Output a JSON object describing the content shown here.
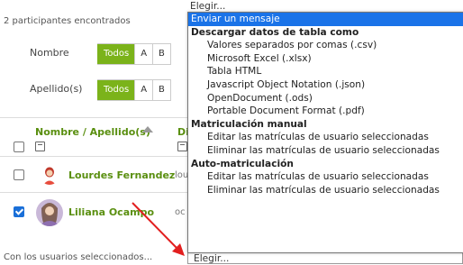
{
  "summary": "2 participantes encontrados",
  "filters": [
    {
      "label": "Nombre",
      "buttons": [
        "Todos",
        "A",
        "B"
      ]
    },
    {
      "label": "Apellido(s)",
      "buttons": [
        "Todos",
        "A",
        "B"
      ]
    }
  ],
  "table": {
    "header": "Nombre / Apellido(s)",
    "header_2": "Di",
    "rows": [
      {
        "name": "Lourdes Fernandez",
        "extra": "lou",
        "checked": false
      },
      {
        "name": "Liliana Ocampo",
        "extra": "oc",
        "checked": true
      }
    ]
  },
  "footer": "Con los usuarios seleccionados...",
  "select": {
    "current": "Elegir...",
    "options": [
      {
        "text": "Elegir...",
        "kind": "option-top"
      },
      {
        "text": "Enviar un mensaje",
        "kind": "highlight"
      },
      {
        "text": "Descargar datos de tabla como",
        "kind": "group"
      },
      {
        "text": "Valores separados por comas (.csv)",
        "kind": "option"
      },
      {
        "text": "Microsoft Excel (.xlsx)",
        "kind": "option"
      },
      {
        "text": "Tabla HTML",
        "kind": "option"
      },
      {
        "text": "Javascript Object Notation (.json)",
        "kind": "option"
      },
      {
        "text": "OpenDocument (.ods)",
        "kind": "option"
      },
      {
        "text": "Portable Document Format (.pdf)",
        "kind": "option"
      },
      {
        "text": "Matriculación manual",
        "kind": "group"
      },
      {
        "text": "Editar las matrículas de usuario seleccionadas",
        "kind": "option"
      },
      {
        "text": "Eliminar las matrículas de usuario seleccionadas",
        "kind": "option"
      },
      {
        "text": "Auto-matriculación",
        "kind": "group"
      },
      {
        "text": "Editar las matrículas de usuario seleccionadas",
        "kind": "option"
      },
      {
        "text": "Eliminar las matrículas de usuario seleccionadas",
        "kind": "option"
      }
    ]
  },
  "colors": {
    "accent": "#7bb31a",
    "highlight": "#1a73e8",
    "arrow": "#e21f1f"
  }
}
